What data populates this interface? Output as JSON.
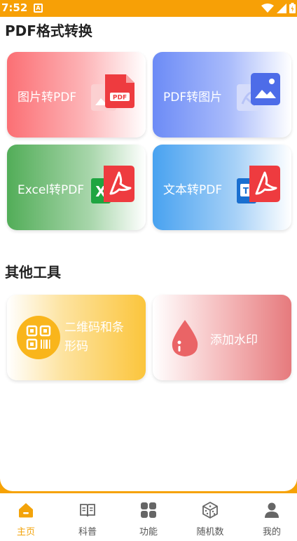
{
  "status_bar": {
    "time": "7:52",
    "notification_letter": "A"
  },
  "sections": {
    "pdf": {
      "title": "PDF格式转换",
      "cards": [
        {
          "label": "图片转PDF",
          "icon": "image-to-pdf-icon"
        },
        {
          "label": "PDF转图片",
          "icon": "pdf-to-image-icon"
        },
        {
          "label": "Excel转PDF",
          "icon": "excel-to-pdf-icon"
        },
        {
          "label": "文本转PDF",
          "icon": "text-to-pdf-icon"
        }
      ]
    },
    "tools": {
      "title": "其他工具",
      "cards": [
        {
          "label": "二维码和条形码",
          "icon": "qrcode-barcode-icon"
        },
        {
          "label": "添加水印",
          "icon": "water-drop-icon"
        }
      ]
    }
  },
  "tabbar": {
    "items": [
      {
        "label": "主页",
        "icon": "home-icon",
        "active": true
      },
      {
        "label": "科普",
        "icon": "book-icon",
        "active": false
      },
      {
        "label": "功能",
        "icon": "grid-icon",
        "active": false
      },
      {
        "label": "随机数",
        "icon": "dice-icon",
        "active": false
      },
      {
        "label": "我的",
        "icon": "person-icon",
        "active": false
      }
    ]
  },
  "colors": {
    "accent": "#f3a30a",
    "pdf_red": "#ee3b3f"
  }
}
